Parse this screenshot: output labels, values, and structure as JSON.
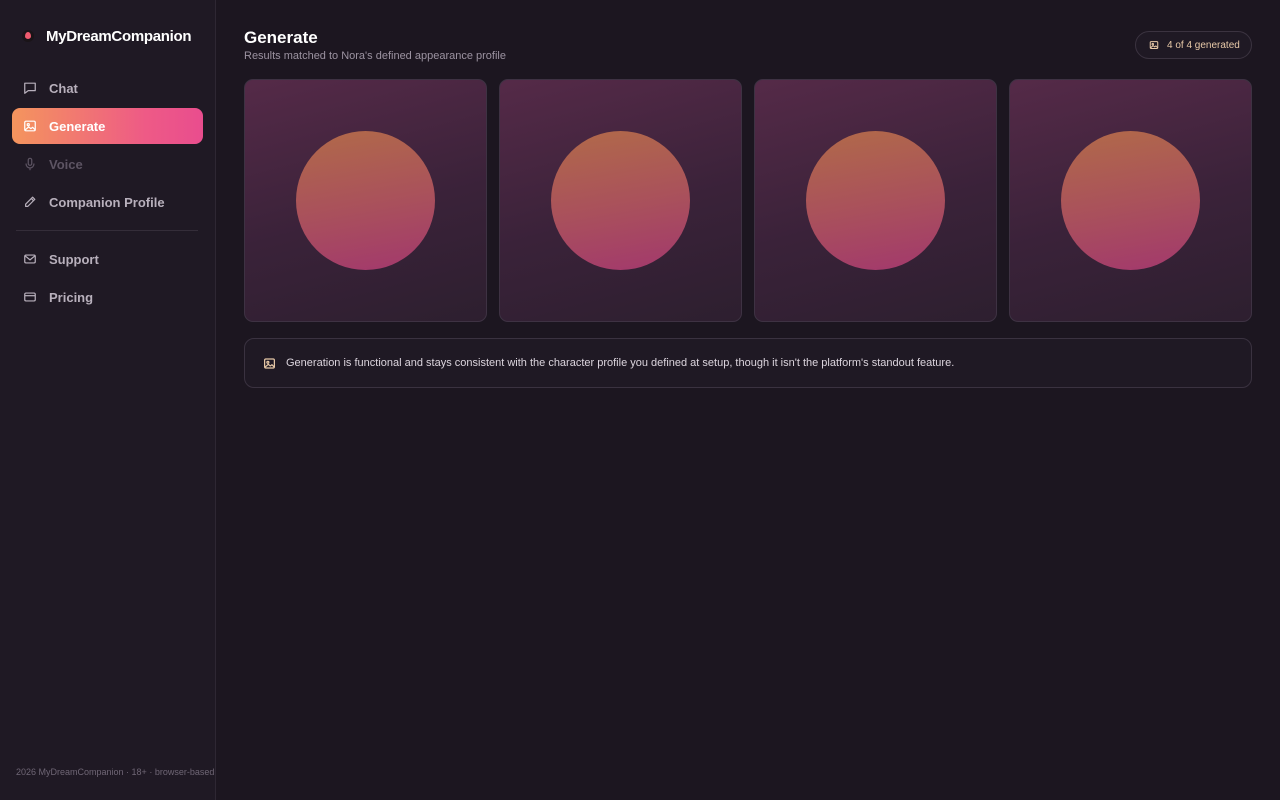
{
  "brand": {
    "name": "MyDreamCompanion"
  },
  "sidebar": {
    "items": [
      {
        "label": "Chat",
        "icon": "chat-icon",
        "state": "normal"
      },
      {
        "label": "Generate",
        "icon": "image-icon",
        "state": "active"
      },
      {
        "label": "Voice",
        "icon": "microphone-icon",
        "state": "disabled"
      },
      {
        "label": "Companion Profile",
        "icon": "pencil-icon",
        "state": "normal"
      },
      {
        "label": "Support",
        "icon": "mail-icon",
        "state": "normal"
      },
      {
        "label": "Pricing",
        "icon": "credit-card-icon",
        "state": "normal"
      }
    ],
    "footer": "2026 MyDreamCompanion · 18+ · browser-based"
  },
  "header": {
    "title": "Generate",
    "subtitle": "Results matched to Nora's defined appearance profile",
    "badge": "4 of 4 generated"
  },
  "gallery": {
    "count": 4
  },
  "note": {
    "text": "Generation is functional and stays consistent with the character profile you defined at setup, though it isn't the platform's standout feature."
  },
  "colors": {
    "accent_start": "#f4955d",
    "accent_end": "#e94d8e",
    "background": "#1c1620",
    "sidebar": "#1f1924"
  }
}
